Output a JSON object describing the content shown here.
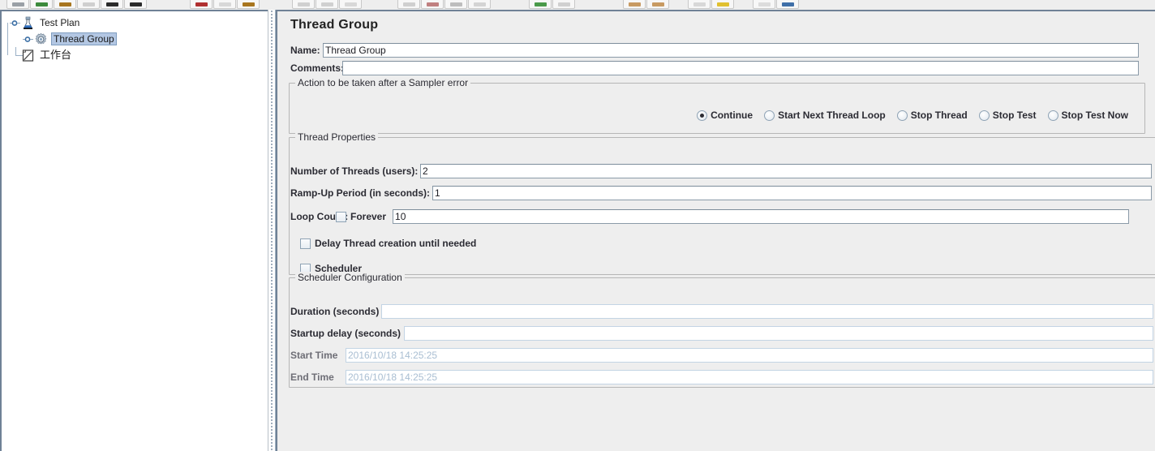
{
  "toolbar": {
    "groups": [
      {
        "buttons": [
          {
            "name": "new-button",
            "icon": "new-file-icon",
            "color": "#9aa0a6"
          },
          {
            "name": "templates-button",
            "icon": "templates-icon",
            "color": "#3c8a3c"
          },
          {
            "name": "open-button",
            "icon": "open-folder-icon",
            "color": "#a8761f"
          },
          {
            "name": "close-button",
            "icon": "close-icon",
            "color": "#cfcfcf"
          },
          {
            "name": "save-button",
            "icon": "save-icon",
            "color": "#2b2b2b"
          },
          {
            "name": "save-as-button",
            "icon": "save-as-icon",
            "color": "#2b2b2b"
          }
        ]
      },
      {
        "buttons": [
          {
            "name": "cut-button",
            "icon": "cut-icon",
            "color": "#b03030"
          },
          {
            "name": "copy-button",
            "icon": "copy-icon",
            "color": "#d8d8d8"
          },
          {
            "name": "paste-button",
            "icon": "paste-icon",
            "color": "#a8761f"
          }
        ]
      },
      {
        "buttons": [
          {
            "name": "expand-all-button",
            "icon": "expand-all-icon",
            "color": "#d0d0d0"
          },
          {
            "name": "collapse-all-button",
            "icon": "collapse-all-icon",
            "color": "#d0d0d0"
          },
          {
            "name": "toggle-button",
            "icon": "toggle-icon",
            "color": "#d8d8d8"
          }
        ]
      },
      {
        "buttons": [
          {
            "name": "start-button",
            "icon": "start-icon",
            "color": "#cfcfcf"
          },
          {
            "name": "start-no-pauses-button",
            "icon": "start-no-pauses-icon",
            "color": "#c08080"
          },
          {
            "name": "stop-button",
            "icon": "stop-icon",
            "color": "#bdbdbd"
          },
          {
            "name": "shutdown-button",
            "icon": "shutdown-icon",
            "color": "#d4d4d4"
          }
        ]
      },
      {
        "buttons": [
          {
            "name": "clear-button",
            "icon": "clear-icon",
            "color": "#4a9a4a"
          },
          {
            "name": "clear-all-button",
            "icon": "clear-all-icon",
            "color": "#d0d0d0"
          }
        ]
      },
      {
        "buttons": [
          {
            "name": "search-button",
            "icon": "search-icon",
            "color": "#c89a62"
          },
          {
            "name": "search-reset-button",
            "icon": "search-reset-icon",
            "color": "#c89a62"
          }
        ]
      },
      {
        "buttons": [
          {
            "name": "function-helper-button",
            "icon": "function-helper-icon",
            "color": "#d8d8d8"
          },
          {
            "name": "help-button",
            "icon": "help-icon",
            "color": "#e0c030"
          }
        ]
      },
      {
        "buttons": [
          {
            "name": "undo-button",
            "icon": "undo-icon",
            "color": "#dcdcdc"
          },
          {
            "name": "redo-button",
            "icon": "redo-icon",
            "color": "#3f6fa8"
          }
        ]
      }
    ]
  },
  "tree": {
    "nodes": [
      {
        "label": "Test Plan",
        "icon": "test-plan-flask-icon",
        "level": 0,
        "selected": false,
        "cjk": false
      },
      {
        "label": "Thread Group",
        "icon": "thread-group-gear-icon",
        "level": 1,
        "selected": true,
        "cjk": false
      },
      {
        "label": "工作台",
        "icon": "workbench-icon",
        "level": 0,
        "selected": false,
        "cjk": true
      }
    ]
  },
  "detail": {
    "title": "Thread Group",
    "name_label": "Name:",
    "name_value": "Thread Group",
    "comments_label": "Comments:",
    "comments_value": "",
    "sampler_error": {
      "group_title": "Action to be taken after a Sampler error",
      "options": [
        {
          "label": "Continue",
          "checked": true
        },
        {
          "label": "Start Next Thread Loop",
          "checked": false
        },
        {
          "label": "Stop Thread",
          "checked": false
        },
        {
          "label": "Stop Test",
          "checked": false
        },
        {
          "label": "Stop Test Now",
          "checked": false
        }
      ]
    },
    "thread_properties": {
      "group_title": "Thread Properties",
      "num_threads_label": "Number of Threads (users):",
      "num_threads_value": "2",
      "ramp_up_label": "Ramp-Up Period (in seconds):",
      "ramp_up_value": "1",
      "loop_count_label": "Loop Count:",
      "forever_label": "Forever",
      "forever_checked": false,
      "loop_count_value": "10",
      "delay_thread_label": "Delay Thread creation until needed",
      "delay_thread_checked": false,
      "scheduler_label": "Scheduler",
      "scheduler_checked": false
    },
    "scheduler_configuration": {
      "group_title": "Scheduler Configuration",
      "duration_label": "Duration (seconds)",
      "duration_value": "",
      "startup_delay_label": "Startup delay (seconds)",
      "startup_delay_value": "",
      "start_time_label": "Start Time",
      "start_time_value": "2016/10/18 14:25:25",
      "end_time_label": "End Time",
      "end_time_value": "2016/10/18 14:25:25"
    }
  },
  "colors": {
    "panel_bg": "#eeeeee",
    "tree_bg": "#ffffff",
    "border_dark": "#6f8196",
    "selection_bg": "#b3c7e3",
    "disabled_text": "#a9bed2",
    "group_border": "#b6b6b6",
    "field_border": "#8a9aa8"
  }
}
